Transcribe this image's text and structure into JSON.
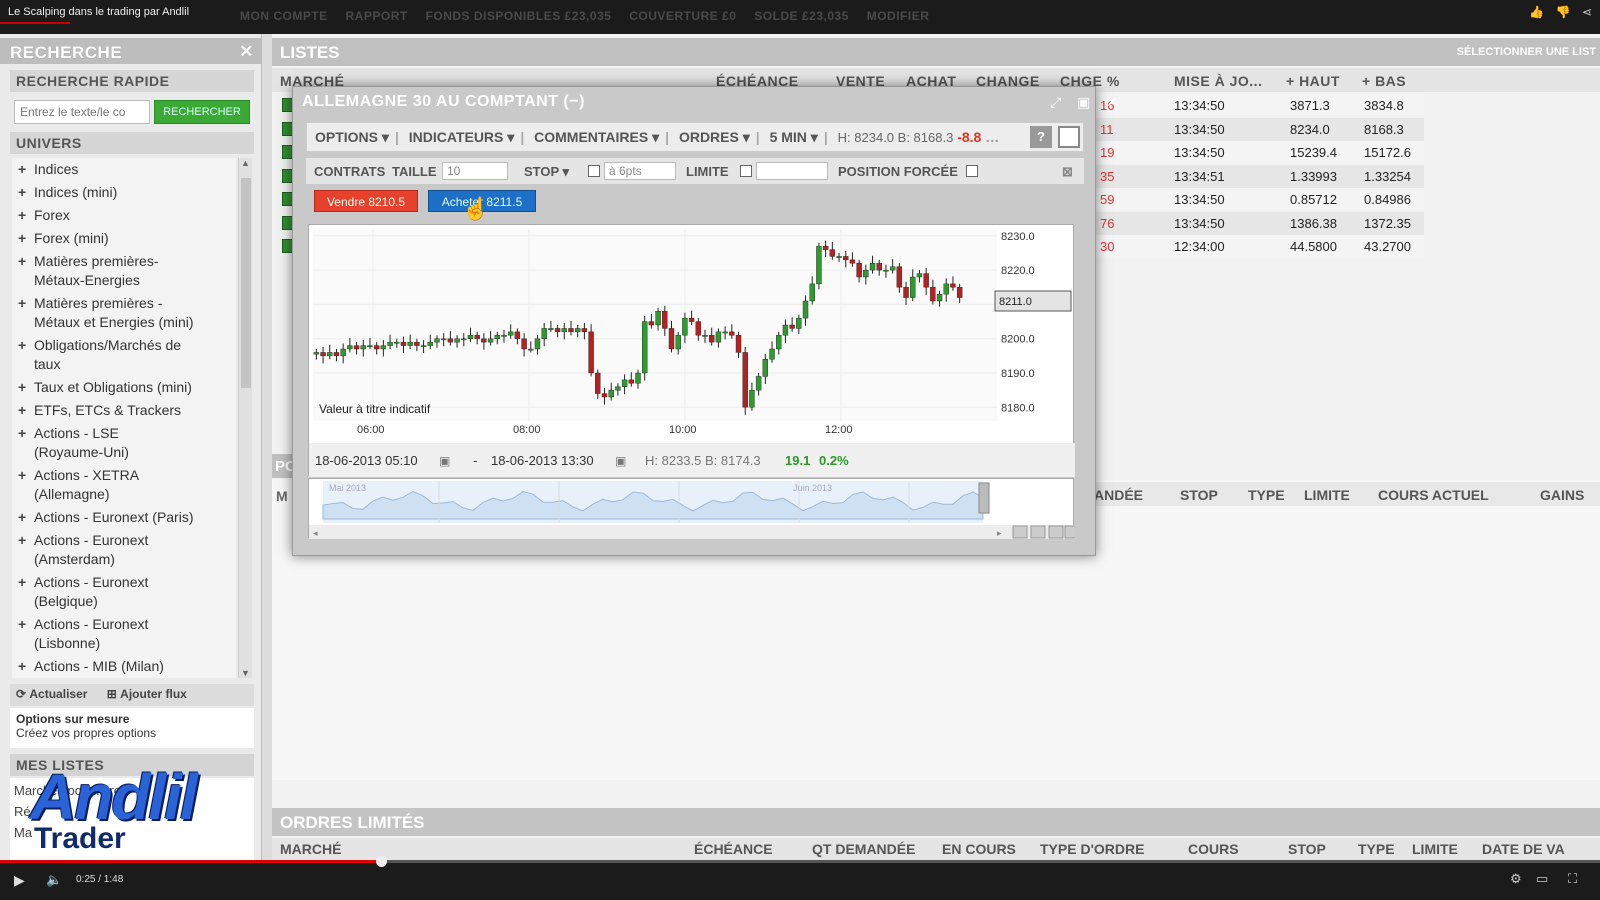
{
  "video": {
    "title": "Le Scalping dans le trading par Andlil",
    "time": "0:25 / 1:48"
  },
  "topnav": [
    "MON COMPTE",
    "RAPPORT",
    "FONDS DISPONIBLES £23,035",
    "COUVERTURE £0",
    "SOLDE £23,035",
    "MODIFIER"
  ],
  "left": {
    "title": "RECHERCHE",
    "quick": "RECHERCHE RAPIDE",
    "search_placeholder": "Entrez le texte/le co",
    "search_button": "RECHERCHER",
    "univers": "UNIVERS",
    "items": [
      [
        "Indices"
      ],
      [
        "Indices (mini)"
      ],
      [
        "Forex"
      ],
      [
        "Forex (mini)"
      ],
      [
        "Matières premières-",
        "Métaux-Energies"
      ],
      [
        "Matières premières -",
        "Métaux et Energies (mini)"
      ],
      [
        "Obligations/Marchés de",
        "taux"
      ],
      [
        "Taux et Obligations (mini)"
      ],
      [
        "ETFs, ETCs & Trackers"
      ],
      [
        "Actions - LSE",
        "(Royaume-Uni)"
      ],
      [
        "Actions - XETRA",
        "(Allemagne)"
      ],
      [
        "Actions - Euronext (Paris)"
      ],
      [
        "Actions - Euronext",
        "(Amsterdam)"
      ],
      [
        "Actions - Euronext",
        "(Belgique)"
      ],
      [
        "Actions - Euronext",
        "(Lisbonne)"
      ],
      [
        "Actions - MIB (Milan)"
      ]
    ],
    "refresh": "Actualiser",
    "add_feed": "Ajouter flux",
    "custom_title": "Options sur mesure",
    "custom_sub": "Créez vos propres options",
    "mes_listes": "MES LISTES",
    "lists": [
      "Marchés populaires",
      "Réc",
      "Ma"
    ]
  },
  "logo": {
    "line1": "Andlil",
    "line2": "Trader Inside"
  },
  "listes": {
    "title": "LISTES",
    "select": "SÉLECTIONNER UNE LIST",
    "cols": [
      "MARCHÉ",
      "ÉCHÉANCE",
      "VENTE",
      "ACHAT",
      "CHANGE",
      "CHGE %",
      "MISE À JO...",
      "+ HAUT",
      "+ BAS"
    ],
    "rows": [
      {
        "chg": "16",
        "time": "13:34:50",
        "high": "3871.3",
        "low": "3834.8"
      },
      {
        "chg": "11",
        "time": "13:34:50",
        "high": "8234.0",
        "low": "8168.3"
      },
      {
        "chg": "19",
        "time": "13:34:50",
        "high": "15239.4",
        "low": "15172.6"
      },
      {
        "chg": "35",
        "time": "13:34:51",
        "high": "1.33993",
        "low": "1.33254"
      },
      {
        "chg": "59",
        "time": "13:34:50",
        "high": "0.85712",
        "low": "0.84986"
      },
      {
        "chg": "76",
        "time": "13:34:50",
        "high": "1386.38",
        "low": "1372.35"
      },
      {
        "chg": "30",
        "time": "12:34:00",
        "high": "44.5800",
        "low": "43.2700"
      }
    ]
  },
  "positions": {
    "label": "PO",
    "m": "M",
    "cols": [
      "ANDÉE",
      "STOP",
      "TYPE",
      "LIMITE",
      "COURS ACTUEL",
      "GAINS"
    ]
  },
  "ordres": {
    "title": "ORDRES LIMITÉS",
    "cols": [
      "MARCHÉ",
      "ÉCHÉANCE",
      "QT DEMANDÉE",
      "EN COURS",
      "TYPE D'ORDRE",
      "COURS",
      "STOP",
      "TYPE",
      "LIMITE",
      "DATE DE VA"
    ]
  },
  "modal": {
    "title": "ALLEMAGNE 30 AU COMPTANT (−)",
    "toolbar": {
      "options": "OPTIONS",
      "indicateurs": "INDICATEURS",
      "commentaires": "COMMENTAIRES",
      "ordres": "ORDRES",
      "interval": "5 MIN",
      "hb": "H: 8234.0 B: 8168.3",
      "chg": "-8.8"
    },
    "contrats": "CONTRATS",
    "taille": "TAILLE",
    "taille_val": "10",
    "stop": "STOP",
    "stop_ph": "à 6pts",
    "limite": "LIMITE",
    "forced": "POSITION FORCÉE",
    "sell": "Vendre 8210.5",
    "buy": "Acheter 8211.5",
    "indicatif": "Valeur à titre indicatif",
    "range_start": "18-06-2013 05:10",
    "range_end": "18-06-2013 13:30",
    "range_hb": "H: 8233.5  B: 8174.3",
    "range_chg": "19.1",
    "range_pct": "0.2%",
    "nav_labels": [
      "Mai 2013",
      "Juin 2013"
    ]
  },
  "chart_data": {
    "type": "candlestick",
    "xlabel": "",
    "ylabel": "",
    "x_ticks": [
      "06:00",
      "08:00",
      "10:00",
      "12:00"
    ],
    "y_ticks": [
      8180.0,
      8190.0,
      8200.0,
      8210.0,
      8220.0,
      8230.0
    ],
    "y_tick_labels": [
      "8180.0",
      "8190.0",
      "8200.0",
      "",
      "8220.0",
      "8230.0"
    ],
    "ylim": [
      8176,
      8232
    ],
    "current_price": "8211.0",
    "current": 8211.0,
    "grid": true,
    "closes": [
      8196,
      8195,
      8196,
      8195,
      8197,
      8198,
      8197,
      8198,
      8198,
      8197,
      8198,
      8199,
      8199,
      8198,
      8199,
      8198,
      8198,
      8199,
      8200,
      8200,
      8199,
      8200,
      8200,
      8201,
      8200,
      8199,
      8200,
      8201,
      8201,
      8202,
      8200,
      8197,
      8197,
      8200,
      8203,
      8203,
      8202,
      8203,
      8202,
      8203,
      8202,
      8190,
      8184,
      8183,
      8185,
      8186,
      8188,
      8187,
      8190,
      8205,
      8204,
      8208,
      8203,
      8197,
      8201,
      8206,
      8205,
      8201,
      8201,
      8199,
      8202,
      8202,
      8201,
      8196,
      8180,
      8185,
      8189,
      8194,
      8197,
      8201,
      8204,
      8203,
      8206,
      8211,
      8216,
      8227,
      8226,
      8224,
      8224,
      8223,
      8222,
      8218,
      8220,
      8222,
      8220,
      8220,
      8221,
      8215,
      8212,
      8218,
      8219,
      8215,
      8211,
      8213,
      8216,
      8215,
      8212
    ]
  }
}
